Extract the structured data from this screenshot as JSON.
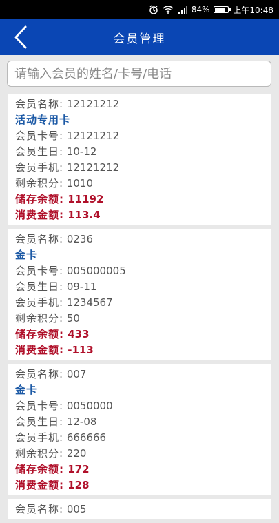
{
  "status": {
    "battery": "84%",
    "time": "上午10:48",
    "battery_level": 0.84
  },
  "header": {
    "title": "会员管理"
  },
  "search": {
    "placeholder": "请输入会员的姓名/卡号/电话"
  },
  "labels": {
    "name": "会员名称:",
    "card": "会员卡号:",
    "birthday": "会员生日:",
    "phone": "会员手机:",
    "points": "剩余积分:",
    "balance": "储存余额:",
    "spent": "消费金额:"
  },
  "members": [
    {
      "name": "12121212",
      "type": "活动专用卡",
      "card": "12121212",
      "birthday": "10-12",
      "phone": "12121212",
      "points": "1010",
      "balance": "11192",
      "spent": "113.4"
    },
    {
      "name": "0236",
      "type": "金卡",
      "card": "005000005",
      "birthday": "09-11",
      "phone": "1234567",
      "points": "50",
      "balance": "433",
      "spent": "-113"
    },
    {
      "name": "007",
      "type": "金卡",
      "card": "0050000",
      "birthday": "12-08",
      "phone": "666666",
      "points": "220",
      "balance": "172",
      "spent": "128"
    },
    {
      "name": "005"
    }
  ]
}
